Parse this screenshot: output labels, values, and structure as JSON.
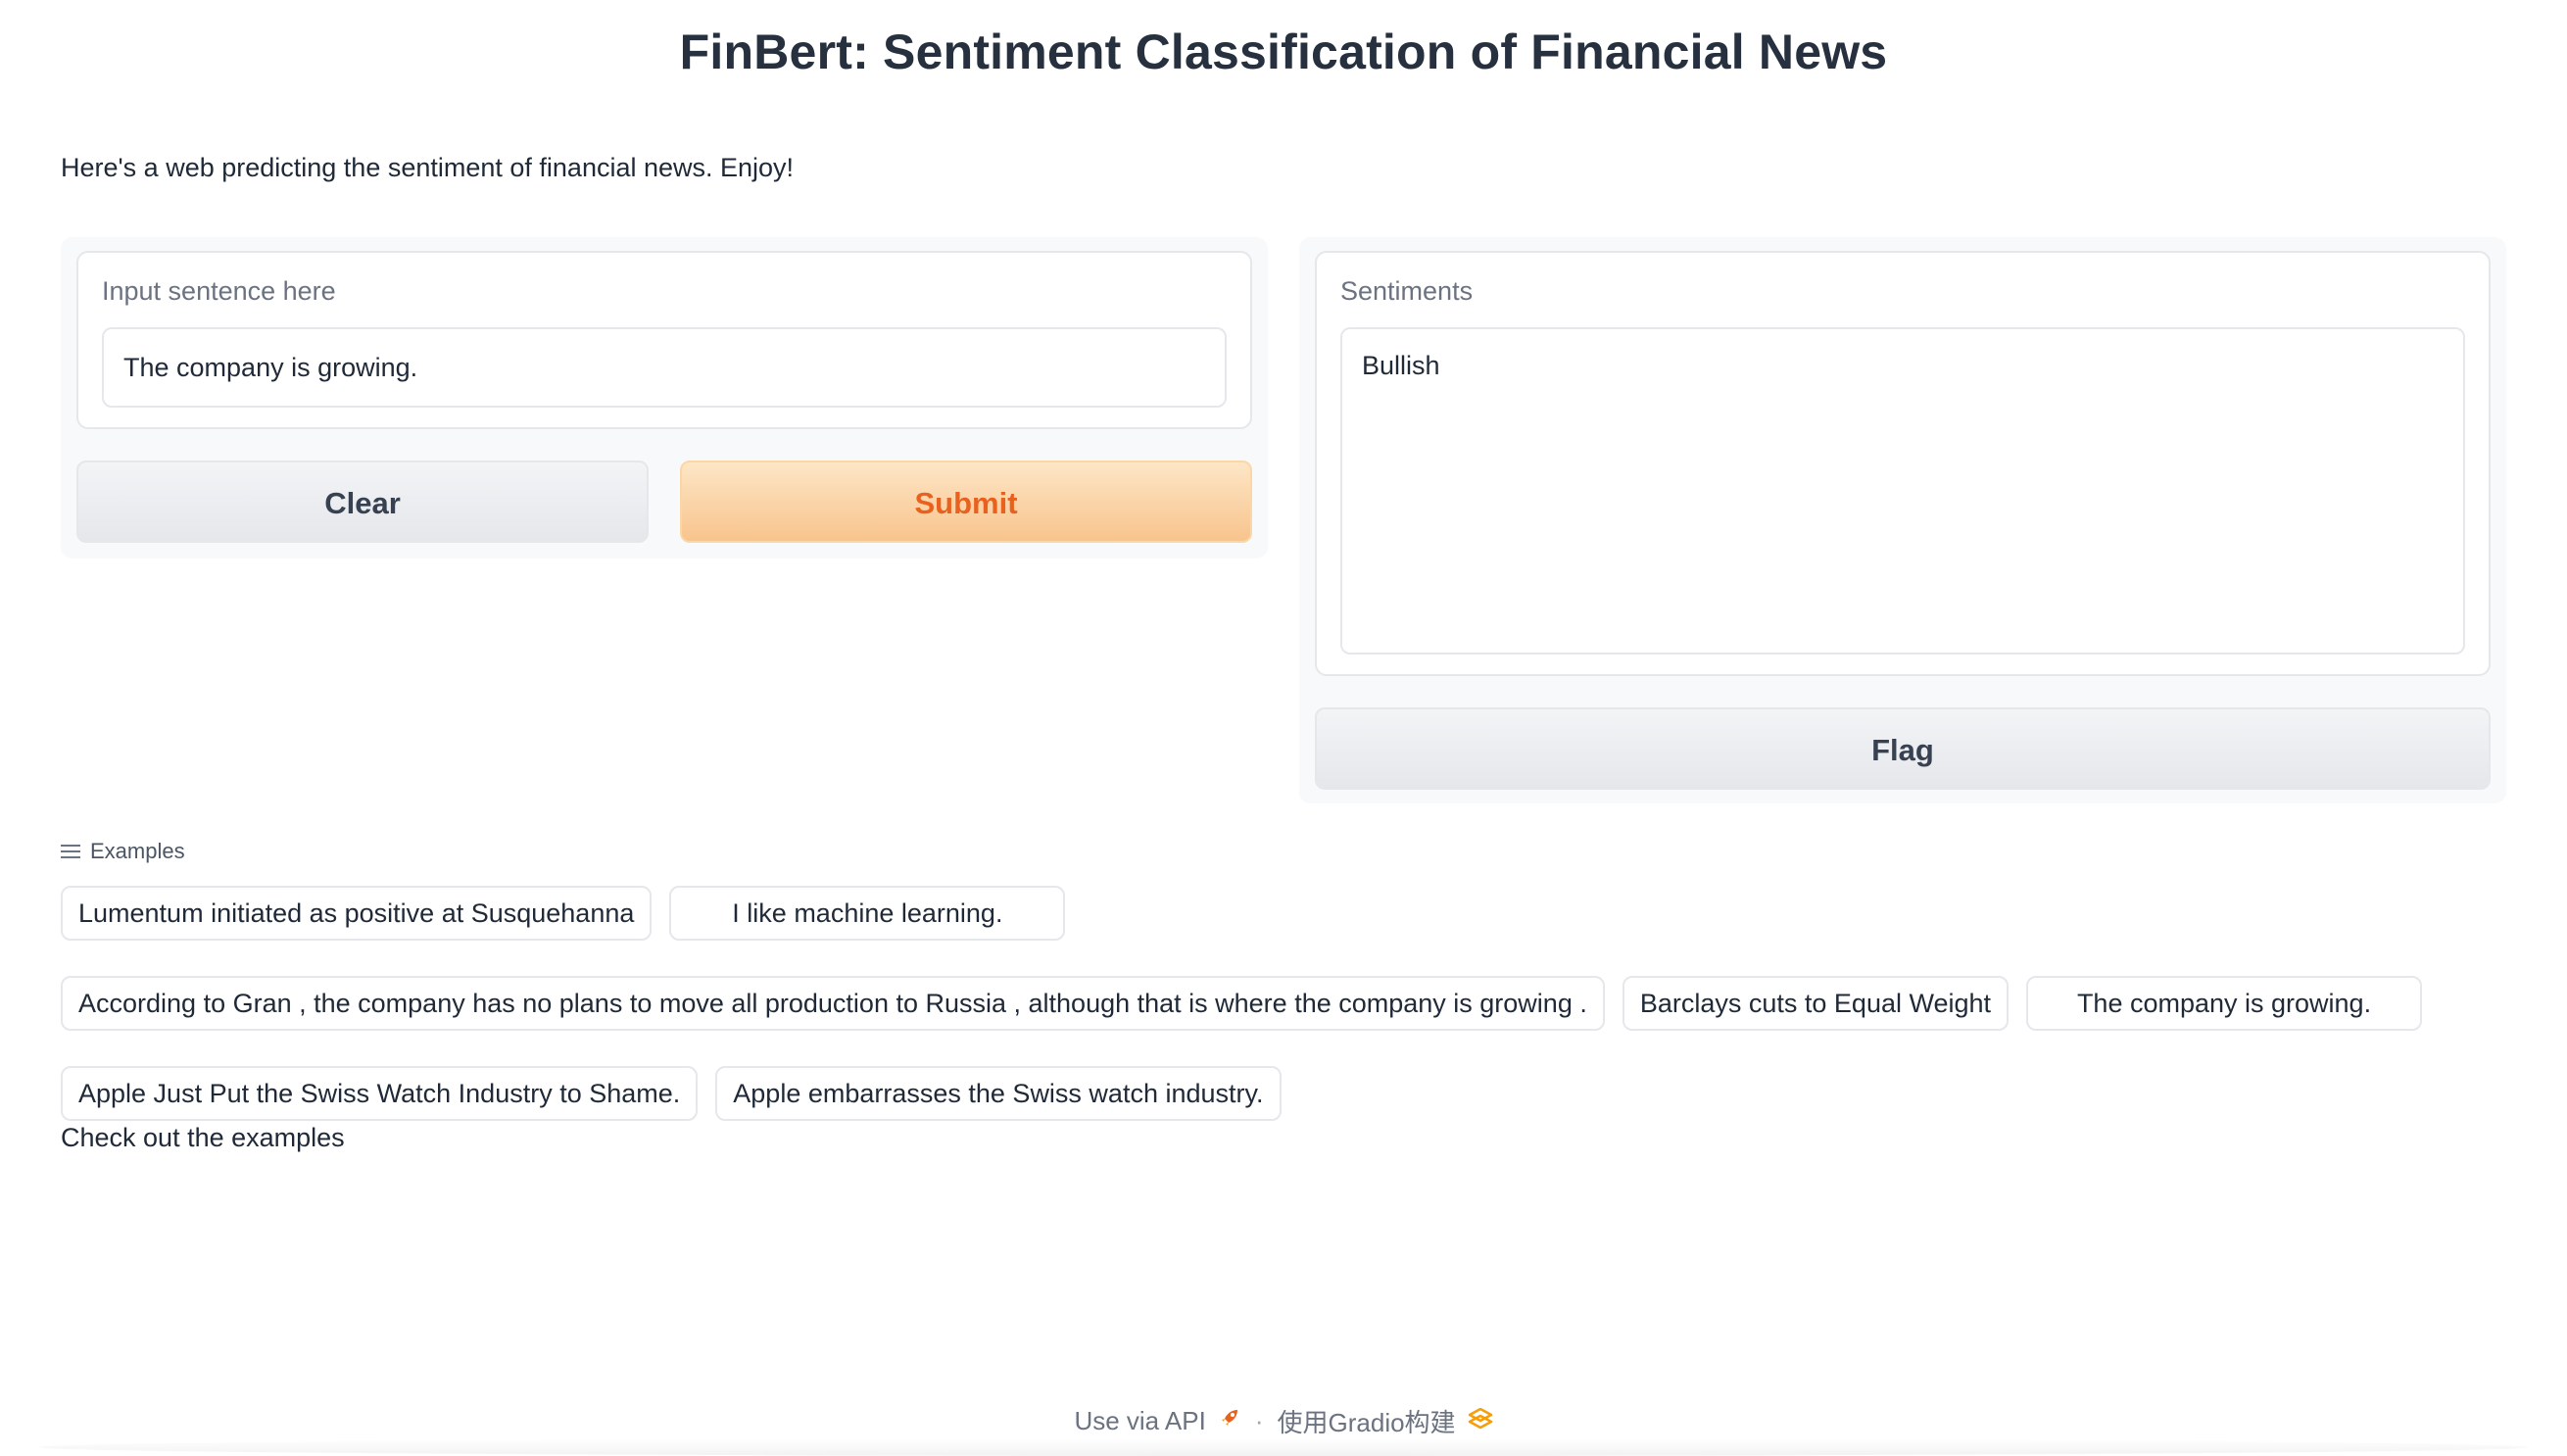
{
  "title": "FinBert: Sentiment Classification of Financial News",
  "description": "Here's a web predicting the sentiment of financial news. Enjoy!",
  "input": {
    "label": "Input sentence here",
    "value": "The company is growing."
  },
  "output": {
    "label": "Sentiments",
    "value": "Bullish"
  },
  "buttons": {
    "clear": "Clear",
    "submit": "Submit",
    "flag": "Flag"
  },
  "examples": {
    "header": "Examples",
    "items": [
      "Lumentum initiated as positive at Susquehanna",
      "I like machine learning.",
      "According to Gran , the company has no plans to move all production to Russia , although that is where the company is growing .",
      "Barclays cuts to Equal Weight",
      "The company is growing.",
      "Apple Just Put the Swiss Watch Industry to Shame.",
      "Apple embarrasses the Swiss watch industry."
    ]
  },
  "article": "Check out the examples",
  "footer": {
    "api_label": "Use via API",
    "separator": "·",
    "built_with": "使用Gradio构建"
  },
  "icons": {
    "examples": "list-icon",
    "api": "rocket-icon",
    "gradio": "gradio-logo-icon"
  },
  "colors": {
    "primary_text": "#e8611e",
    "primary_bg": "#f8c48d"
  }
}
